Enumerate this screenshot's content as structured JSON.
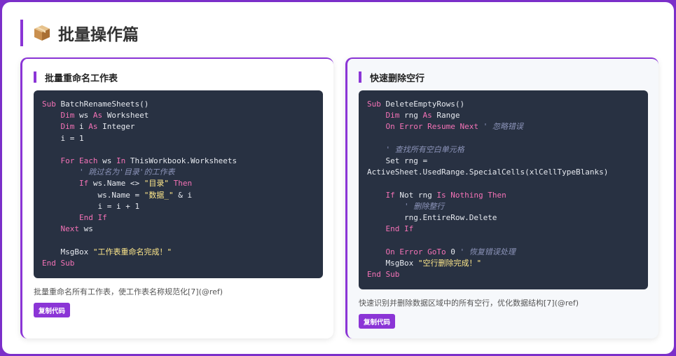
{
  "section": {
    "title": "批量操作篇",
    "icon": "package-icon"
  },
  "cards": [
    {
      "title": "批量重命名工作表",
      "code_lines": [
        [
          {
            "t": "Sub",
            "c": "kw"
          },
          {
            "t": " BatchRenameSheets()"
          }
        ],
        [
          {
            "t": "    "
          },
          {
            "t": "Dim",
            "c": "kw"
          },
          {
            "t": " ws "
          },
          {
            "t": "As",
            "c": "kw"
          },
          {
            "t": " Worksheet"
          }
        ],
        [
          {
            "t": "    "
          },
          {
            "t": "Dim",
            "c": "kw"
          },
          {
            "t": " i "
          },
          {
            "t": "As",
            "c": "kw"
          },
          {
            "t": " Integer"
          }
        ],
        [
          {
            "t": "    i = 1"
          }
        ],
        [
          {
            "t": ""
          }
        ],
        [
          {
            "t": "    "
          },
          {
            "t": "For Each",
            "c": "kw"
          },
          {
            "t": " ws "
          },
          {
            "t": "In",
            "c": "kw"
          },
          {
            "t": " ThisWorkbook.Worksheets"
          }
        ],
        [
          {
            "t": "        "
          },
          {
            "t": "' 跳过名为'目录'的工作表",
            "c": "cm"
          }
        ],
        [
          {
            "t": "        "
          },
          {
            "t": "If",
            "c": "kw"
          },
          {
            "t": " ws.Name <> "
          },
          {
            "t": "\"目录\"",
            "c": "str"
          },
          {
            "t": " "
          },
          {
            "t": "Then",
            "c": "kw"
          }
        ],
        [
          {
            "t": "            ws.Name = "
          },
          {
            "t": "\"数据_\"",
            "c": "str"
          },
          {
            "t": " & i"
          }
        ],
        [
          {
            "t": "            i = i + 1"
          }
        ],
        [
          {
            "t": "        "
          },
          {
            "t": "End If",
            "c": "kw"
          }
        ],
        [
          {
            "t": "    "
          },
          {
            "t": "Next",
            "c": "kw"
          },
          {
            "t": " ws"
          }
        ],
        [
          {
            "t": ""
          }
        ],
        [
          {
            "t": "    MsgBox "
          },
          {
            "t": "\"工作表重命名完成！\"",
            "c": "str"
          }
        ],
        [
          {
            "t": "End Sub",
            "c": "kw"
          }
        ]
      ],
      "description": "批量重命名所有工作表，使工作表名称规范化[7](@ref)",
      "copy_label": "复制代码"
    },
    {
      "title": "快速删除空行",
      "code_lines": [
        [
          {
            "t": "Sub",
            "c": "kw"
          },
          {
            "t": " DeleteEmptyRows()"
          }
        ],
        [
          {
            "t": "    "
          },
          {
            "t": "Dim",
            "c": "kw"
          },
          {
            "t": " rng "
          },
          {
            "t": "As",
            "c": "kw"
          },
          {
            "t": " Range"
          }
        ],
        [
          {
            "t": "    "
          },
          {
            "t": "On Error Resume Next",
            "c": "kw"
          },
          {
            "t": " "
          },
          {
            "t": "' 忽略错误",
            "c": "cm"
          }
        ],
        [
          {
            "t": ""
          }
        ],
        [
          {
            "t": "    "
          },
          {
            "t": "' 查找所有空白单元格",
            "c": "cm"
          }
        ],
        [
          {
            "t": "    Set rng ="
          }
        ],
        [
          {
            "t": "ActiveSheet.UsedRange.SpecialCells(xlCellTypeBlanks)"
          }
        ],
        [
          {
            "t": ""
          }
        ],
        [
          {
            "t": "    "
          },
          {
            "t": "If",
            "c": "kw"
          },
          {
            "t": " Not rng "
          },
          {
            "t": "Is Nothing Then",
            "c": "kw"
          }
        ],
        [
          {
            "t": "        "
          },
          {
            "t": "' 删除整行",
            "c": "cm"
          }
        ],
        [
          {
            "t": "        rng.EntireRow.Delete"
          }
        ],
        [
          {
            "t": "    "
          },
          {
            "t": "End If",
            "c": "kw"
          }
        ],
        [
          {
            "t": ""
          }
        ],
        [
          {
            "t": "    "
          },
          {
            "t": "On Error GoTo",
            "c": "kw"
          },
          {
            "t": " 0 "
          },
          {
            "t": "' 恢复错误处理",
            "c": "cm"
          }
        ],
        [
          {
            "t": "    MsgBox "
          },
          {
            "t": "\"空行删除完成！\"",
            "c": "str"
          }
        ],
        [
          {
            "t": "End Sub",
            "c": "kw"
          }
        ]
      ],
      "description": "快速识别并删除数据区域中的所有空行，优化数据结构[7](@ref)",
      "copy_label": "复制代码"
    }
  ],
  "colors": {
    "accent": "#8b35d6",
    "code_bg": "#283142",
    "keyword": "#f472b6",
    "string": "#fde68a",
    "comment": "#8b93b8",
    "page_border": "#7b2fc9"
  }
}
